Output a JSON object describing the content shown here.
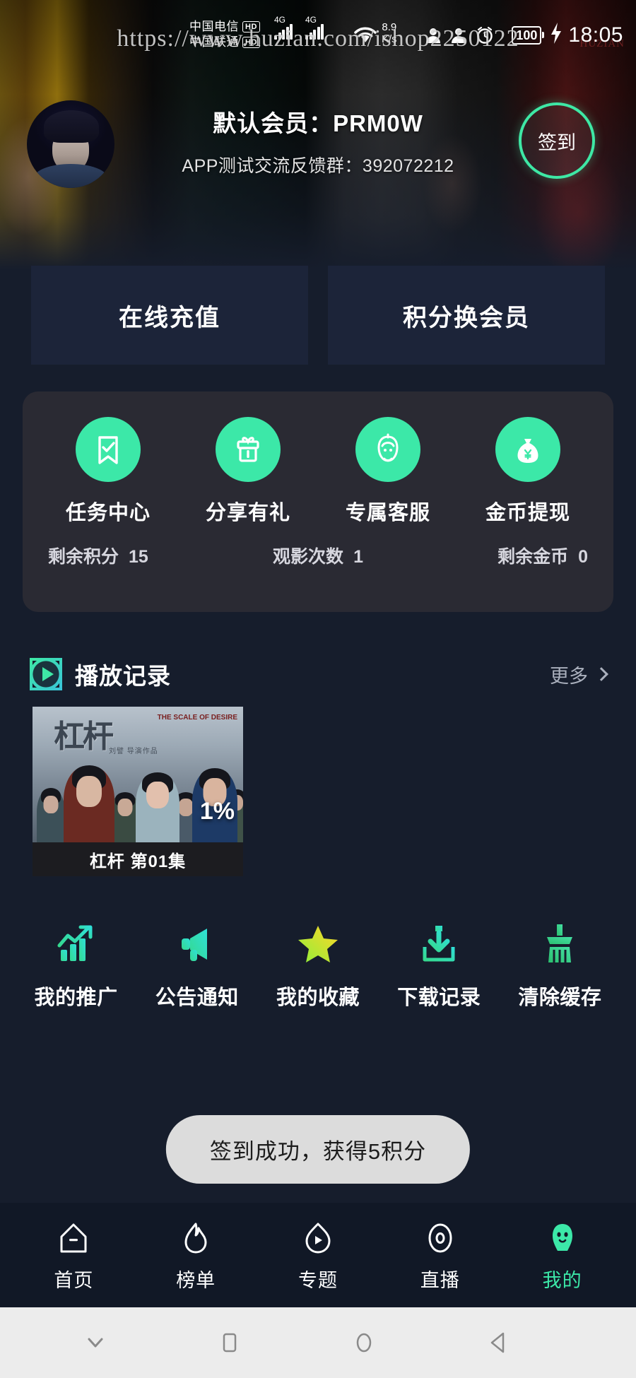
{
  "status_bar": {
    "carrier_1": "中国电信",
    "carrier_1_badge": "HD",
    "carrier_2": "中国联通",
    "carrier_2_badge": "HD",
    "network_1": "4G",
    "network_2": "4G",
    "speed_value": "8.9",
    "speed_unit": "K/s",
    "battery_level": "100",
    "time": "18:05"
  },
  "watermark": {
    "url": "https://www.huzian.com/ishop2250122",
    "corner": "HUZIAN"
  },
  "header": {
    "member_label": "默认会员：",
    "member_code": "PRM0W",
    "member_line": "默认会员：PRM0W",
    "group_line": "APP测试交流反馈群：392072212",
    "signin_label": "签到",
    "signin_ring_color": "#3ee8a5"
  },
  "top_actions": [
    {
      "label": "在线充值",
      "name": "recharge-button"
    },
    {
      "label": "积分换会员",
      "name": "points-exchange-button"
    }
  ],
  "grid": {
    "accent_color": "#3ce8a8",
    "card_color": "#2a2a33",
    "items": [
      {
        "label": "任务中心",
        "icon": "task-bookmark-icon"
      },
      {
        "label": "分享有礼",
        "icon": "gift-box-icon"
      },
      {
        "label": "专属客服",
        "icon": "customer-service-icon"
      },
      {
        "label": "金币提现",
        "icon": "money-bag-icon"
      }
    ],
    "stats": [
      {
        "label": "剩余积分",
        "value": "15"
      },
      {
        "label": "观影次数",
        "value": "1"
      },
      {
        "label": "剩余金币",
        "value": "0"
      }
    ]
  },
  "play_history": {
    "title": "播放记录",
    "more_label": "更多",
    "item": {
      "title": "杠杆 第01集",
      "progress": "1%",
      "poster_title": "杠杆",
      "poster_subtitle": "THE SCALE OF DESIRE",
      "poster_credit": "刘譬 导演作品"
    }
  },
  "menu": [
    {
      "label": "我的推广",
      "icon": "growth-chart-icon"
    },
    {
      "label": "公告通知",
      "icon": "megaphone-icon"
    },
    {
      "label": "我的收藏",
      "icon": "star-icon"
    },
    {
      "label": "下载记录",
      "icon": "download-icon"
    },
    {
      "label": "清除缓存",
      "icon": "broom-icon"
    }
  ],
  "toast": {
    "message": "签到成功，获得5积分"
  },
  "bottom_nav": {
    "active_color": "#3ce8a8",
    "items": [
      {
        "label": "首页",
        "icon": "home-icon",
        "active": false
      },
      {
        "label": "榜单",
        "icon": "flame-icon",
        "active": false
      },
      {
        "label": "专题",
        "icon": "topic-play-icon",
        "active": false
      },
      {
        "label": "直播",
        "icon": "live-circle-icon",
        "active": false
      },
      {
        "label": "我的",
        "icon": "profile-person-icon",
        "active": true
      }
    ]
  },
  "system_nav": [
    {
      "icon": "chevron-down-icon"
    },
    {
      "icon": "recents-square-icon"
    },
    {
      "icon": "home-circle-icon"
    },
    {
      "icon": "back-triangle-icon"
    }
  ]
}
